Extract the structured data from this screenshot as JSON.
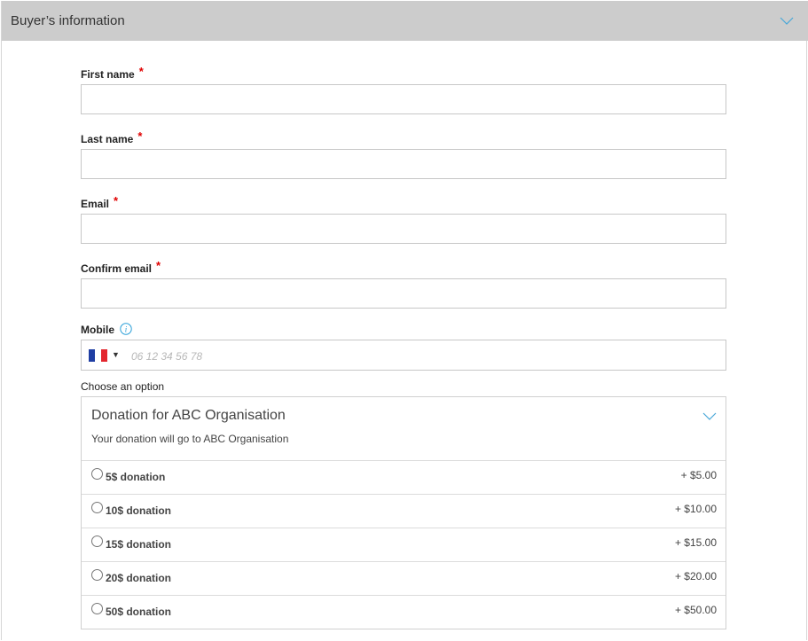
{
  "header": {
    "title": "Buyer’s information",
    "chevron_icon": "chevron-down-icon",
    "accent": "#4aa8d8"
  },
  "fields": {
    "first_name": {
      "label": "First name",
      "required_mark": "*",
      "value": ""
    },
    "last_name": {
      "label": "Last name",
      "required_mark": "*",
      "value": ""
    },
    "email": {
      "label": "Email",
      "required_mark": "*",
      "value": ""
    },
    "confirm_email": {
      "label": "Confirm email",
      "required_mark": "*",
      "value": ""
    },
    "mobile": {
      "label": "Mobile",
      "info_icon": "info-icon",
      "country_flag": "france-flag-icon",
      "placeholder": "06 12 34 56 78",
      "value": ""
    }
  },
  "option": {
    "choose_label": "Choose an option",
    "title": "Donation for ABC Organisation",
    "subtitle": "Your donation will go to ABC Organisation",
    "rows": [
      {
        "label": "5$ donation",
        "price": "+ $5.00",
        "selected": false
      },
      {
        "label": "10$ donation",
        "price": "+ $10.00",
        "selected": false
      },
      {
        "label": "15$ donation",
        "price": "+ $15.00",
        "selected": false
      },
      {
        "label": "20$ donation",
        "price": "+ $20.00",
        "selected": false
      },
      {
        "label": "50$ donation",
        "price": "+ $50.00",
        "selected": false
      }
    ]
  },
  "colors": {
    "required": "#e00000",
    "header_bg": "#cccccc",
    "border": "#c7c7c7"
  }
}
